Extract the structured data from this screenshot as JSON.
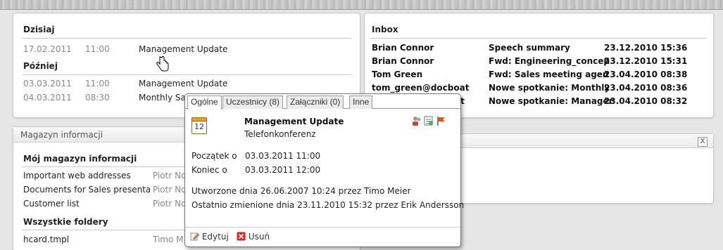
{
  "calendar": {
    "today_title": "Dzisiaj",
    "today": [
      {
        "date": "17.02.2011",
        "time": "11:00",
        "title": "Management Update"
      }
    ],
    "later_title": "Później",
    "later": [
      {
        "date": "03.03.2011",
        "time": "11:00",
        "title": "Management Update"
      },
      {
        "date": "04.03.2011",
        "time": "08:30",
        "title": "Monthly Sa"
      }
    ]
  },
  "inbox": {
    "title": "Inbox",
    "rows": [
      {
        "from": "Brian Connor",
        "subject": "Speech summary",
        "date": "23.12.2010 15:36"
      },
      {
        "from": "Brian Connor",
        "subject": "Fwd: Engineering_concep",
        "date": "23.12.2010 15:31"
      },
      {
        "from": "Tom Green",
        "subject": "Fwd: Sales meeting agen",
        "date": "23.04.2010 08:38"
      },
      {
        "from": "tom_green@docboat",
        "subject": "Nowe spotkanie: Monthly",
        "date": "23.04.2010 08:36"
      },
      {
        "from": "at",
        "subject": "Nowe spotkanie: Manager",
        "date": "23.04.2010 08:32"
      }
    ]
  },
  "infostore": {
    "panel_title": "Magazyn informacji",
    "my_title": "Mój magazyn informacji",
    "my_items": [
      {
        "name": "Important web addresses",
        "owner": "Piotr No"
      },
      {
        "name": "Documents for Sales presentati",
        "owner": "Piotr No"
      },
      {
        "name": "Customer list",
        "owner": "Piotr No"
      }
    ],
    "all_title": "Wszystkie foldery",
    "all_items": [
      {
        "name": "hcard.tmpl",
        "owner": "Timo M"
      }
    ]
  },
  "right_panel": {
    "close_label": "X"
  },
  "popup": {
    "tabs": [
      "Ogólne",
      "Uczestnicy (8)",
      "Załączniki (0)",
      "Inne"
    ],
    "calendar_day": "12",
    "title": "Management Update",
    "subtitle": "Telefonkonferenz",
    "start_label": "Początek o",
    "start_value": "03.03.2011 11:00",
    "end_label": "Koniec o",
    "end_value": "03.03.2011 12:00",
    "created": "Utworzone dnia 26.06.2007 10:24 przez Timo Meier",
    "modified": "Ostatnio zmienione dnia 23.11.2010 15:32 przez Erik Andersson",
    "edit_label": "Edytuj",
    "delete_label": "Usuń"
  },
  "colors": {
    "flag": "#e8501c",
    "delete": "#d22",
    "edit": "#e8a11c"
  }
}
